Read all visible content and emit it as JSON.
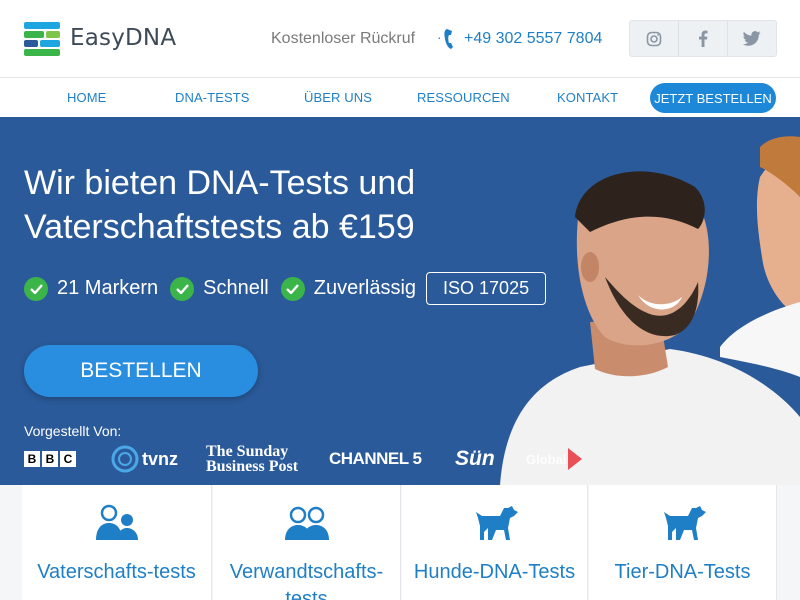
{
  "brand": {
    "name": "EasyDNA",
    "colors": {
      "green": "#3bb54a",
      "blue": "#2a5a99",
      "link": "#1f7fc6"
    }
  },
  "header": {
    "callback_label": "Kostenloser Rückruf",
    "phone": "+49 302 5557 7804",
    "social": [
      {
        "name": "instagram-icon"
      },
      {
        "name": "facebook-icon"
      },
      {
        "name": "twitter-icon"
      }
    ]
  },
  "nav": {
    "items": [
      "HOME",
      "DNA-TESTS",
      "ÜBER UNS",
      "RESSOURCEN",
      "KONTAKT"
    ],
    "cta": "JETZT BESTELLEN"
  },
  "hero": {
    "title": "Wir bieten DNA-Tests und Vaterschaftstests ab €159",
    "features": [
      "21 Markern",
      "Schnell",
      "Zuverlässig"
    ],
    "iso": "ISO 17025",
    "order_button": "BESTELLEN",
    "presented_by": "Vorgestellt Von:",
    "media": [
      "BBC",
      "tvnz",
      "The Sunday Business Post",
      "CHANNEL 5",
      "Sün",
      "Global"
    ]
  },
  "services": [
    {
      "label": "Vaterschafts-tests",
      "icon": "parent-child-icon"
    },
    {
      "label": "Verwandtschafts-tests",
      "icon": "family-icon"
    },
    {
      "label": "Hunde-DNA-Tests",
      "icon": "dog-icon"
    },
    {
      "label": "Tier-DNA-Tests",
      "icon": "dog-icon"
    }
  ]
}
